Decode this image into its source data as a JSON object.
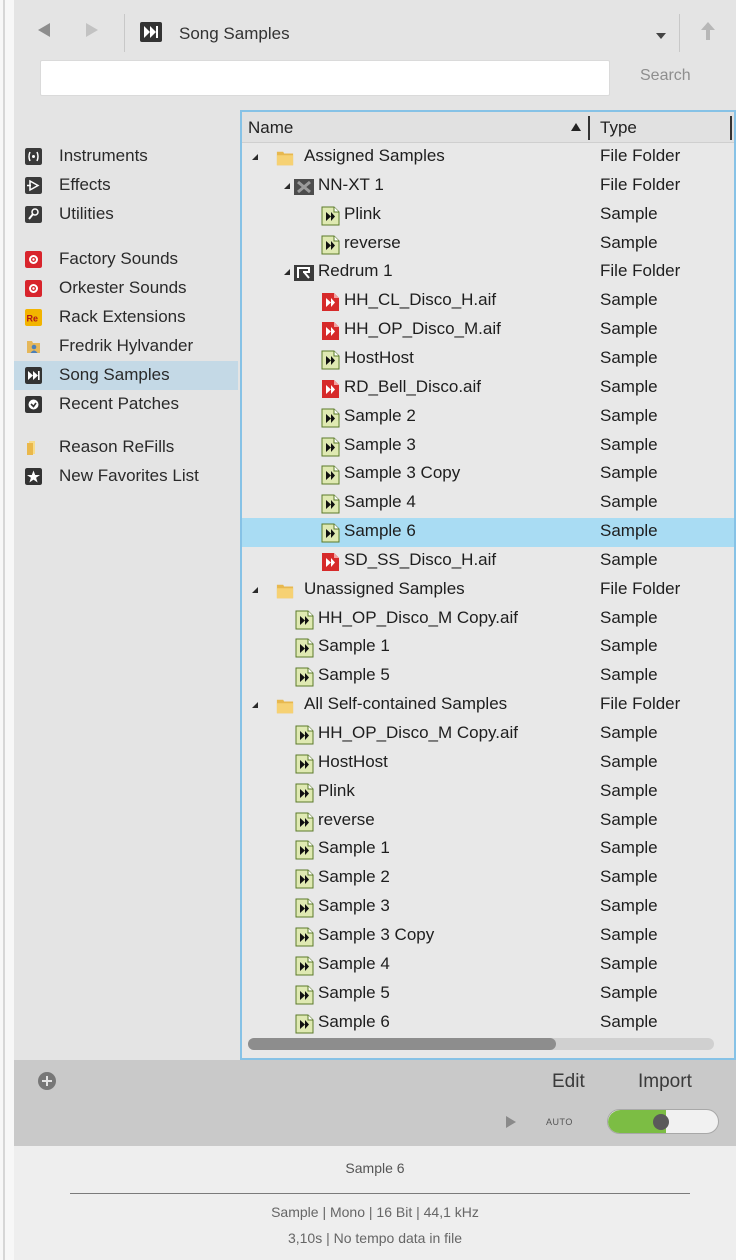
{
  "header": {
    "location_title": "Song Samples",
    "search_button": "Search",
    "search_value": ""
  },
  "sidebar": {
    "items": [
      {
        "label": "Instruments",
        "icon": "instruments-icon",
        "color": "#3a3a3a"
      },
      {
        "label": "Effects",
        "icon": "effects-icon",
        "color": "#3a3a3a"
      },
      {
        "label": "Utilities",
        "icon": "utilities-icon",
        "color": "#3a3a3a"
      },
      {
        "label": "Factory Sounds",
        "icon": "factory-sounds-icon",
        "color": "#d8242c"
      },
      {
        "label": "Orkester Sounds",
        "icon": "orkester-sounds-icon",
        "color": "#d8242c"
      },
      {
        "label": "Rack Extensions",
        "icon": "rack-extensions-icon",
        "color": "#f2b400"
      },
      {
        "label": "Fredrik Hylvander",
        "icon": "user-folder-icon",
        "color": "#e5b75a"
      },
      {
        "label": "Song Samples",
        "icon": "song-samples-icon",
        "color": "#333333"
      },
      {
        "label": "Recent Patches",
        "icon": "recent-patches-icon",
        "color": "#333333"
      },
      {
        "label": "Reason ReFills",
        "icon": "refills-folder-icon",
        "color": "#f0c060"
      },
      {
        "label": "New Favorites List",
        "icon": "favorites-star-icon",
        "color": "#333333"
      }
    ],
    "selected": "Song Samples"
  },
  "columns": {
    "name": "Name",
    "type": "Type"
  },
  "rows": [
    {
      "label": "Assigned Samples",
      "type": "File Folder",
      "icon": "folder",
      "level": 0,
      "expanded": true
    },
    {
      "label": "NN-XT 1",
      "type": "File Folder",
      "icon": "nnxt",
      "level": 1,
      "expanded": true
    },
    {
      "label": "Plink",
      "type": "Sample",
      "icon": "sample-green",
      "level": 2
    },
    {
      "label": "reverse",
      "type": "Sample",
      "icon": "sample-green",
      "level": 2
    },
    {
      "label": "Redrum 1",
      "type": "File Folder",
      "icon": "redrum",
      "level": 1,
      "expanded": true
    },
    {
      "label": "HH_CL_Disco_H.aif",
      "type": "Sample",
      "icon": "sample-red",
      "level": 2
    },
    {
      "label": "HH_OP_Disco_M.aif",
      "type": "Sample",
      "icon": "sample-red",
      "level": 2
    },
    {
      "label": "HostHost",
      "type": "Sample",
      "icon": "sample-green",
      "level": 2
    },
    {
      "label": "RD_Bell_Disco.aif",
      "type": "Sample",
      "icon": "sample-red",
      "level": 2
    },
    {
      "label": "Sample 2",
      "type": "Sample",
      "icon": "sample-green",
      "level": 2
    },
    {
      "label": "Sample 3",
      "type": "Sample",
      "icon": "sample-green",
      "level": 2
    },
    {
      "label": "Sample 3 Copy",
      "type": "Sample",
      "icon": "sample-green",
      "level": 2
    },
    {
      "label": "Sample 4",
      "type": "Sample",
      "icon": "sample-green",
      "level": 2
    },
    {
      "label": "Sample 6",
      "type": "Sample",
      "icon": "sample-green",
      "level": 2,
      "selected": true
    },
    {
      "label": "SD_SS_Disco_H.aif",
      "type": "Sample",
      "icon": "sample-red",
      "level": 2
    },
    {
      "label": "Unassigned Samples",
      "type": "File Folder",
      "icon": "folder",
      "level": 0,
      "expanded": true
    },
    {
      "label": "HH_OP_Disco_M Copy.aif",
      "type": "Sample",
      "icon": "sample-green",
      "level": 1
    },
    {
      "label": "Sample 1",
      "type": "Sample",
      "icon": "sample-green",
      "level": 1
    },
    {
      "label": "Sample 5",
      "type": "Sample",
      "icon": "sample-green",
      "level": 1
    },
    {
      "label": "All Self-contained Samples",
      "type": "File Folder",
      "icon": "folder",
      "level": 0,
      "expanded": true
    },
    {
      "label": "HH_OP_Disco_M Copy.aif",
      "type": "Sample",
      "icon": "sample-green",
      "level": 1
    },
    {
      "label": "HostHost",
      "type": "Sample",
      "icon": "sample-green",
      "level": 1
    },
    {
      "label": "Plink",
      "type": "Sample",
      "icon": "sample-green",
      "level": 1
    },
    {
      "label": "reverse",
      "type": "Sample",
      "icon": "sample-green",
      "level": 1
    },
    {
      "label": "Sample 1",
      "type": "Sample",
      "icon": "sample-green",
      "level": 1
    },
    {
      "label": "Sample 2",
      "type": "Sample",
      "icon": "sample-green",
      "level": 1
    },
    {
      "label": "Sample 3",
      "type": "Sample",
      "icon": "sample-green",
      "level": 1
    },
    {
      "label": "Sample 3 Copy",
      "type": "Sample",
      "icon": "sample-green",
      "level": 1
    },
    {
      "label": "Sample 4",
      "type": "Sample",
      "icon": "sample-green",
      "level": 1
    },
    {
      "label": "Sample 5",
      "type": "Sample",
      "icon": "sample-green",
      "level": 1
    },
    {
      "label": "Sample 6",
      "type": "Sample",
      "icon": "sample-green",
      "level": 1
    }
  ],
  "toolbar": {
    "edit_label": "Edit",
    "import_label": "Import",
    "auto_label": "AUTO",
    "auto_on": true
  },
  "info": {
    "title": "Sample 6",
    "line1": "Sample | Mono | 16 Bit | 44,1 kHz",
    "line2": "3,10s | No tempo data in file"
  },
  "colors": {
    "accent_border": "#86c2e6",
    "row_selected": "#a9dcf3",
    "sidebar_selected": "#c4d9e6",
    "toggle_on": "#7cbd44"
  }
}
